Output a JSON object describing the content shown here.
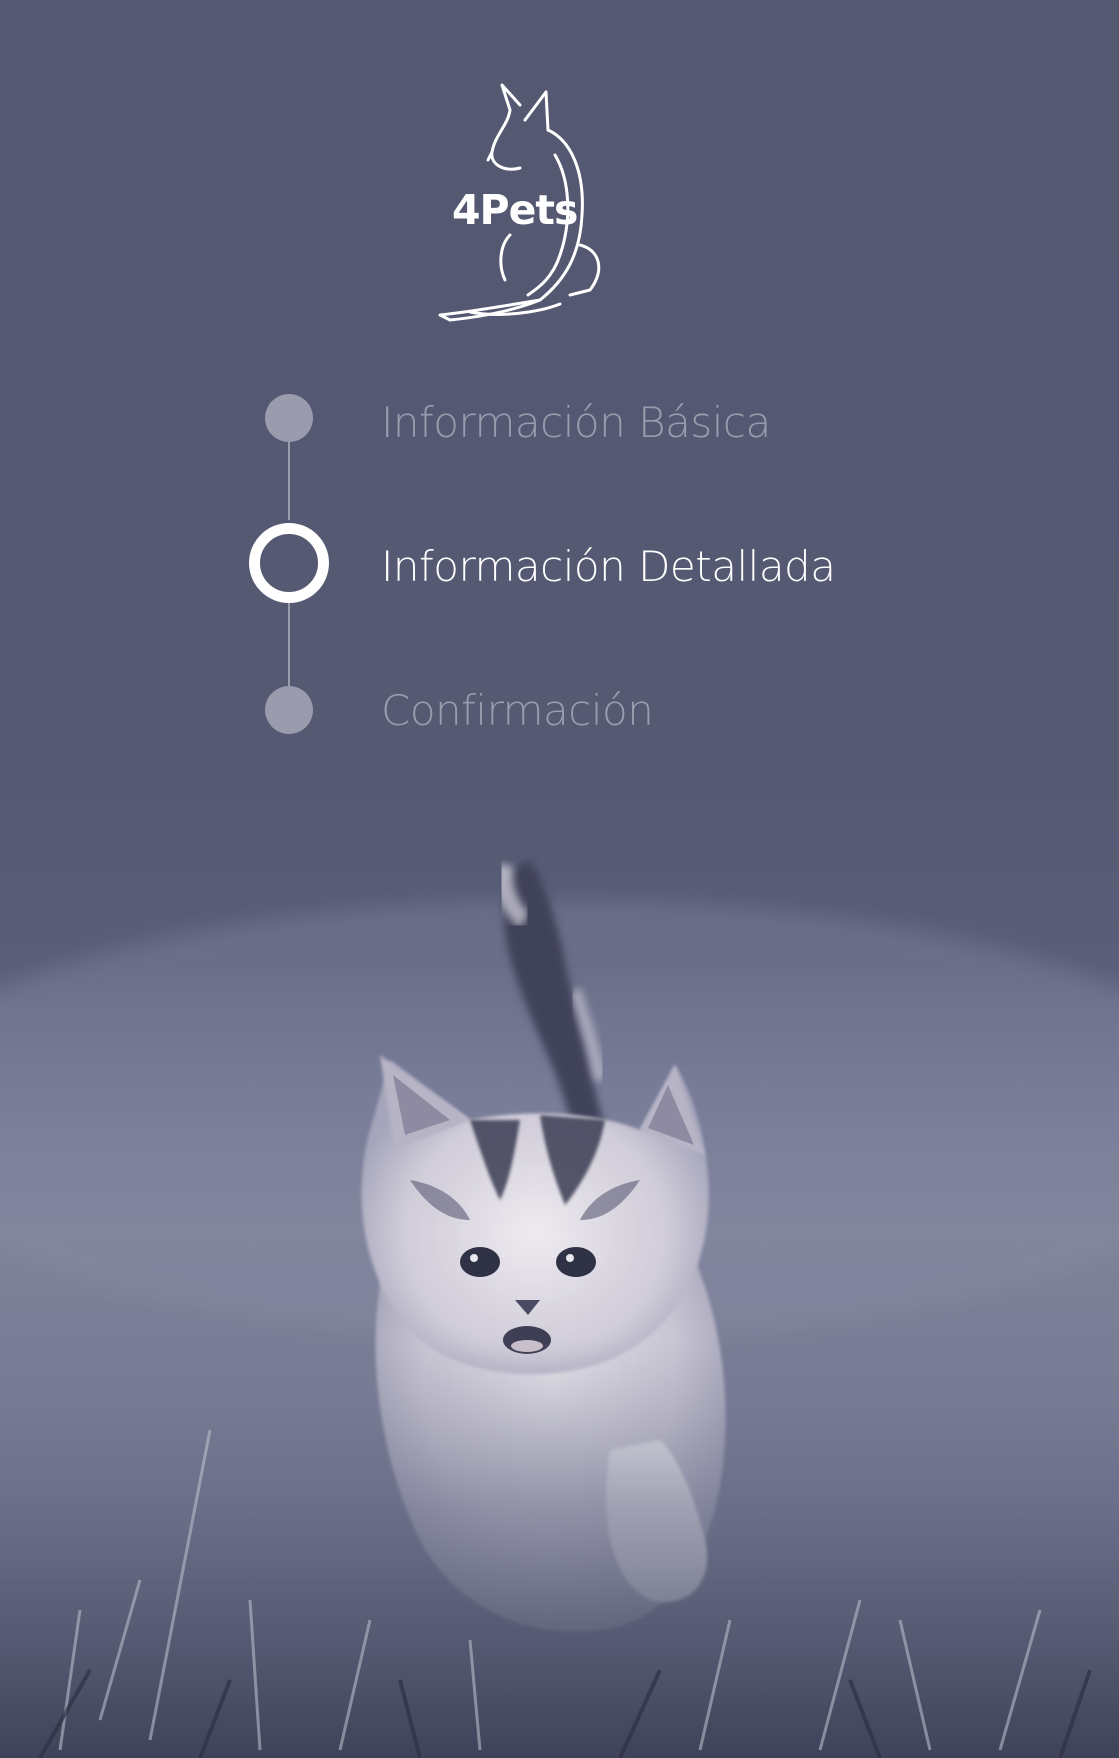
{
  "app": {
    "brand_name": "4Pets",
    "logo_icon": "kangaroo-logo-icon"
  },
  "stepper": {
    "steps": [
      {
        "label": "Información Básica",
        "state": "inactive"
      },
      {
        "label": "Información Detallada",
        "state": "active"
      },
      {
        "label": "Confirmación",
        "state": "inactive"
      }
    ],
    "current_step": 2
  },
  "background": {
    "image": "kitten-in-grass",
    "tint": "#545871"
  },
  "colors": {
    "background": "#545871",
    "active": "#ffffff",
    "inactive": "#9a9cae"
  }
}
